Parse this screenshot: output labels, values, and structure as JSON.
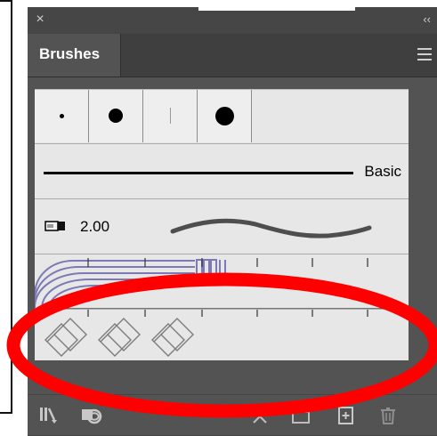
{
  "window": {
    "close_icon": "close-icon",
    "collapse_icon": "double-chevron-left-icon"
  },
  "panel": {
    "tab_label": "Brushes",
    "menu_icon": "hamburger-menu-icon"
  },
  "brushes": {
    "basic_label": "Basic",
    "brush_size": "2.00"
  },
  "footer": {
    "icons": [
      "brush-libraries-icon",
      "libraries-panel-icon",
      "remove-stroke-icon",
      "brush-options-icon",
      "new-brush-icon",
      "delete-brush-icon"
    ]
  },
  "annotation": {
    "color": "#ff0000"
  }
}
